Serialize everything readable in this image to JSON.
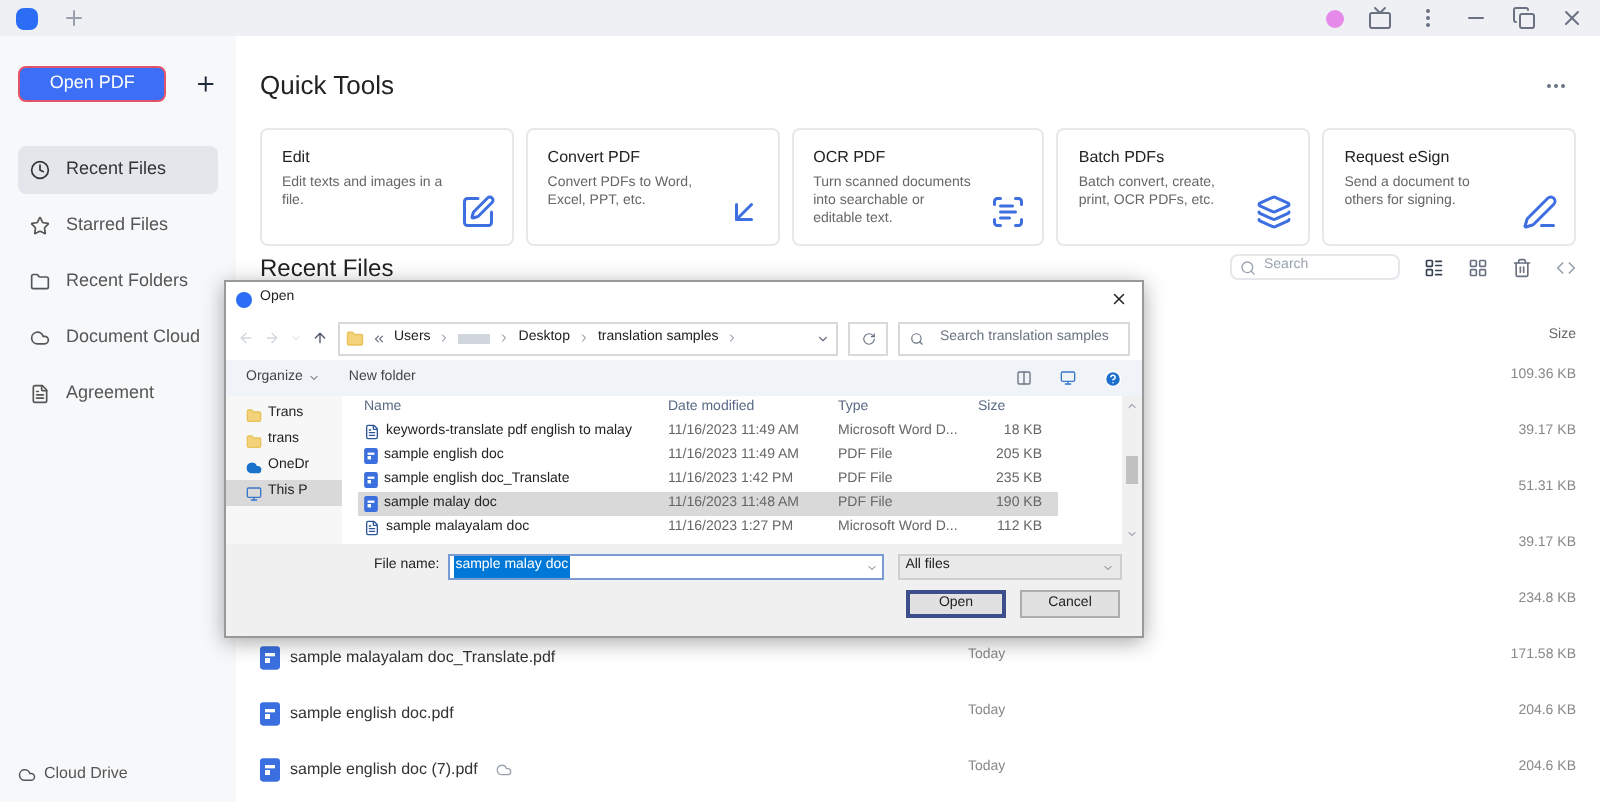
{
  "sidebar": {
    "open_button": "Open PDF",
    "items": [
      {
        "label": "Recent Files",
        "kind": "clock",
        "selected": true
      },
      {
        "label": "Starred Files",
        "kind": "star",
        "selected": false
      },
      {
        "label": "Recent Folders",
        "kind": "folder",
        "selected": false
      },
      {
        "label": "Document Cloud",
        "kind": "cloud",
        "selected": false
      },
      {
        "label": "Agreement",
        "kind": "doc",
        "selected": false
      }
    ],
    "footer": "Cloud Drive"
  },
  "quick_tools": {
    "title": "Quick Tools",
    "cards": [
      {
        "title": "Edit",
        "description": "Edit texts and images in a file.",
        "kind": "edit"
      },
      {
        "title": "Convert PDF",
        "description": "Convert PDFs to Word, Excel, PPT, etc.",
        "kind": "convert"
      },
      {
        "title": "OCR PDF",
        "description": "Turn scanned documents into searchable or editable text.",
        "kind": "ocr"
      },
      {
        "title": "Batch PDFs",
        "description": "Batch convert, create, print, OCR PDFs, etc.",
        "kind": "batch"
      },
      {
        "title": "Request eSign",
        "description": "Send a document to others for signing.",
        "kind": "sign"
      }
    ]
  },
  "recent_files": {
    "title": "Recent Files",
    "search": {
      "placeholder": "Search"
    },
    "size_header": "Size",
    "rows": [
      {
        "size": "109.36 KB"
      },
      {
        "size": "39.17 KB"
      },
      {
        "size": "51.31 KB"
      },
      {
        "size": "39.17 KB"
      },
      {
        "size": "234.8 KB"
      },
      {
        "name": "sample malayalam doc_Translate.pdf",
        "date": "Today",
        "size": "171.58 KB",
        "cloud": false
      },
      {
        "name": "sample english doc.pdf",
        "date": "Today",
        "size": "204.6 KB",
        "cloud": false
      },
      {
        "name": "sample english doc (7).pdf",
        "date": "Today",
        "size": "204.6 KB",
        "cloud": true
      }
    ]
  },
  "dialog": {
    "title": "Open",
    "path": [
      "Users",
      "Desktop",
      "translation samples"
    ],
    "search": {
      "placeholder": "Search translation samples"
    },
    "organize": "Organize",
    "new_folder": "New folder",
    "nav": [
      {
        "label": "Trans",
        "kind": "folder",
        "selected": false
      },
      {
        "label": "trans",
        "kind": "folder",
        "selected": false
      },
      {
        "label": "OneDr",
        "kind": "cloud",
        "selected": false
      },
      {
        "label": "This P",
        "kind": "pc",
        "selected": true
      }
    ],
    "columns": [
      "Name",
      "Date modified",
      "Type",
      "Size"
    ],
    "files": [
      {
        "name": "keywords-translate pdf english to malay",
        "date": "11/16/2023 11:49 AM",
        "type": "Microsoft Word D...",
        "size": "18 KB",
        "kind": "word",
        "selected": false
      },
      {
        "name": "sample english doc",
        "date": "11/16/2023 11:49 AM",
        "type": "PDF File",
        "size": "205 KB",
        "kind": "pdf",
        "selected": false
      },
      {
        "name": "sample english doc_Translate",
        "date": "11/16/2023 1:42 PM",
        "type": "PDF File",
        "size": "235 KB",
        "kind": "pdf",
        "selected": false
      },
      {
        "name": "sample malay doc",
        "date": "11/16/2023 11:48 AM",
        "type": "PDF File",
        "size": "190 KB",
        "kind": "pdf",
        "selected": true
      },
      {
        "name": "sample malayalam doc",
        "date": "11/16/2023 1:27 PM",
        "type": "Microsoft Word D...",
        "size": "112 KB",
        "kind": "word",
        "selected": false
      }
    ],
    "file_name_label": "File name:",
    "file_name": "sample malay doc",
    "filter": "All files",
    "buttons": [
      {
        "label": "Open",
        "focused": true
      },
      {
        "label": "Cancel",
        "focused": false
      }
    ]
  }
}
